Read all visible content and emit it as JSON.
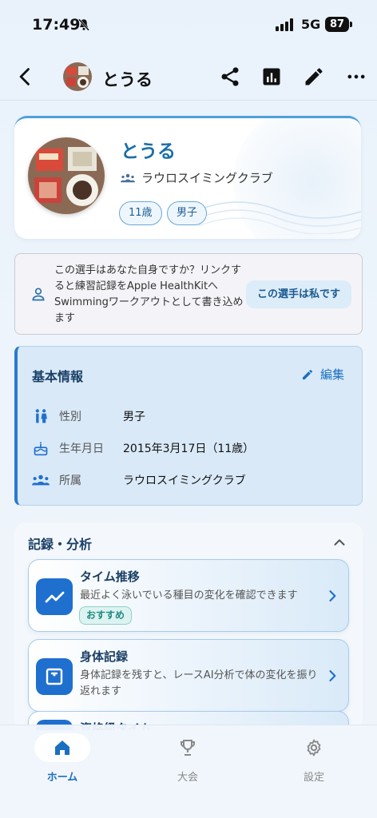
{
  "status_bar": {
    "time": "17:49",
    "network": "5G",
    "battery": "87"
  },
  "nav": {
    "title": "とうる"
  },
  "profile": {
    "name": "とうる",
    "club": "ラウロスイミングクラブ",
    "chips": [
      "11歳",
      "男子"
    ]
  },
  "link_card": {
    "text": "この選手はあなた自身ですか？リンクすると練習記録をApple HealthKitへSwimmingワークアウトとして書き込めます",
    "button": "この選手は私です"
  },
  "basic_info": {
    "title": "基本情報",
    "edit_label": "編集",
    "rows": [
      {
        "label": "性別",
        "value": "男子",
        "icon": "gender-icon"
      },
      {
        "label": "生年月日",
        "value": "2015年3月17日（11歳）",
        "icon": "cake-icon"
      },
      {
        "label": "所属",
        "value": "ラウロスイミングクラブ",
        "icon": "group-icon"
      }
    ]
  },
  "analysis": {
    "title": "記録・分析",
    "cards": [
      {
        "title": "タイム推移",
        "desc": "最近よく泳いでいる種目の変化を確認できます",
        "badge": "おすすめ",
        "icon": "trend-icon"
      },
      {
        "title": "身体記録",
        "desc": "身体記録を残すと、レースAI分析で体の変化を振り返れます",
        "icon": "scale-icon"
      },
      {
        "title": "資格級タイム",
        "icon": "badge-icon"
      }
    ]
  },
  "tabbar": {
    "tabs": [
      {
        "label": "ホーム",
        "icon": "home-icon",
        "active": true
      },
      {
        "label": "大会",
        "icon": "trophy-icon"
      },
      {
        "label": "設定",
        "icon": "gear-icon"
      }
    ]
  },
  "colors": {
    "accent": "#1f6fcf",
    "title": "#1a6fa8"
  }
}
